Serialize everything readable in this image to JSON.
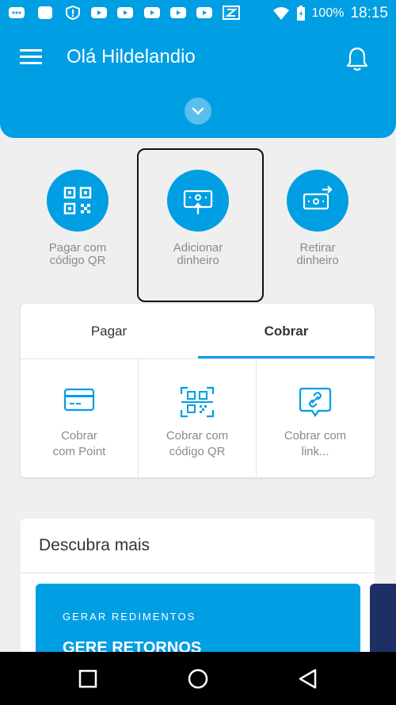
{
  "status_bar": {
    "battery": "100%",
    "time": "18:15"
  },
  "header": {
    "greeting": "Olá Hildelandio"
  },
  "quick_actions": [
    {
      "label_line1": "Pagar com",
      "label_line2": "código QR",
      "icon": "qr-code-icon"
    },
    {
      "label_line1": "Adicionar",
      "label_line2": "dinheiro",
      "icon": "add-money-icon"
    },
    {
      "label_line1": "Retirar",
      "label_line2": "dinheiro",
      "icon": "withdraw-money-icon"
    }
  ],
  "tabs": {
    "pagar": "Pagar",
    "cobrar": "Cobrar",
    "active": "Cobrar"
  },
  "tiles": [
    {
      "line1": "Cobrar",
      "line2": "com Point",
      "icon": "card-icon"
    },
    {
      "line1": "Cobrar com",
      "line2": "código QR",
      "icon": "qr-scan-icon"
    },
    {
      "line1": "Cobrar com",
      "line2": "link...",
      "icon": "link-icon"
    }
  ],
  "discover": {
    "title": "Descubra mais",
    "promo_kicker": "GERAR REDIMENTOS",
    "promo_title": "GERE RETORNOS"
  },
  "colors": {
    "brand": "#009ee3",
    "promo_dark": "#1e2f66"
  }
}
